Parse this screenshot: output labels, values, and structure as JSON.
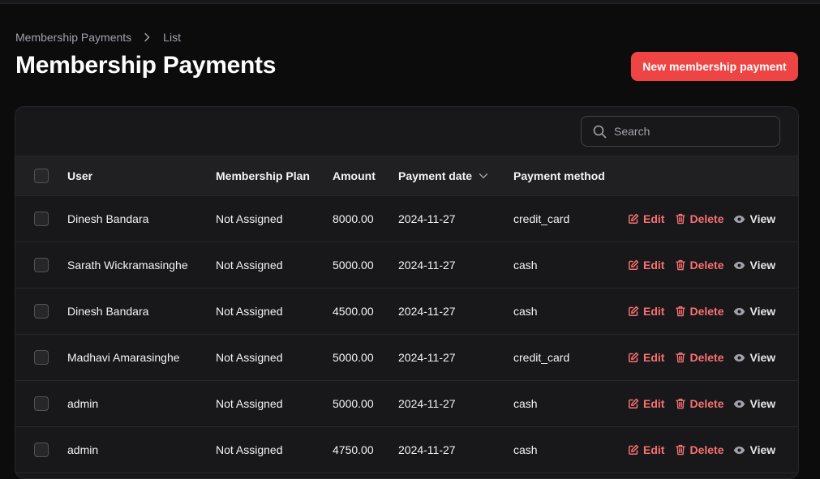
{
  "breadcrumb": {
    "parent": "Membership Payments",
    "current": "List"
  },
  "page": {
    "title": "Membership Payments",
    "new_button": "New membership payment"
  },
  "search": {
    "placeholder": "Search"
  },
  "table": {
    "headers": {
      "user": "User",
      "plan": "Membership Plan",
      "amount": "Amount",
      "date": "Payment date",
      "method": "Payment method"
    },
    "actions": {
      "edit": "Edit",
      "delete": "Delete",
      "view": "View"
    },
    "rows": [
      {
        "user": "Dinesh Bandara",
        "plan": "Not Assigned",
        "amount": "8000.00",
        "date": "2024-11-27",
        "method": "credit_card"
      },
      {
        "user": "Sarath Wickramasinghe",
        "plan": "Not Assigned",
        "amount": "5000.00",
        "date": "2024-11-27",
        "method": "cash"
      },
      {
        "user": "Dinesh Bandara",
        "plan": "Not Assigned",
        "amount": "4500.00",
        "date": "2024-11-27",
        "method": "cash"
      },
      {
        "user": "Madhavi Amarasinghe",
        "plan": "Not Assigned",
        "amount": "5000.00",
        "date": "2024-11-27",
        "method": "credit_card"
      },
      {
        "user": "admin",
        "plan": "Not Assigned",
        "amount": "5000.00",
        "date": "2024-11-27",
        "method": "cash"
      },
      {
        "user": "admin",
        "plan": "Not Assigned",
        "amount": "4750.00",
        "date": "2024-11-27",
        "method": "cash"
      }
    ]
  },
  "colors": {
    "accent": "#ef4444",
    "action_danger": "#f87171",
    "background": "#0c0c0d",
    "panel": "#18181b"
  },
  "icons": {
    "breadcrumb_separator": "chevron-right-icon",
    "search": "search-icon",
    "sort": "chevron-down-icon",
    "edit": "pencil-square-icon",
    "delete": "trash-icon",
    "view": "eye-icon"
  }
}
